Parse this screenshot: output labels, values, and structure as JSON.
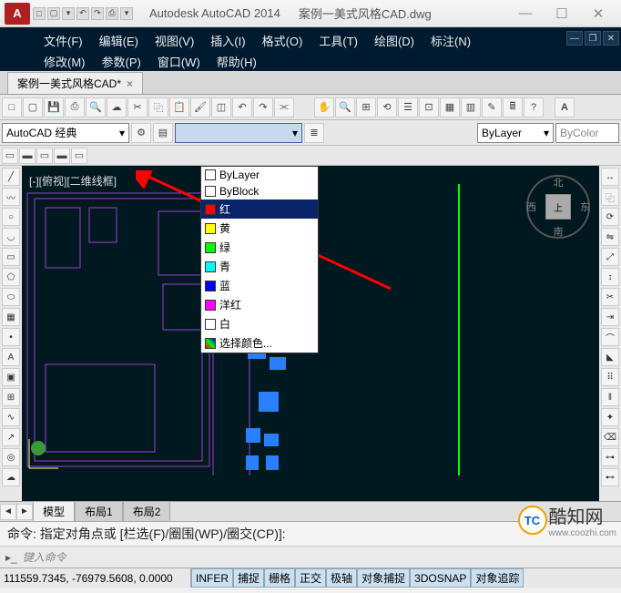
{
  "title": {
    "app": "Autodesk AutoCAD 2014",
    "doc": "案例一美式风格CAD.dwg"
  },
  "menubar": {
    "row1": [
      {
        "label": "文件(F)"
      },
      {
        "label": "编辑(E)"
      },
      {
        "label": "视图(V)"
      },
      {
        "label": "插入(I)"
      },
      {
        "label": "格式(O)"
      },
      {
        "label": "工具(T)"
      },
      {
        "label": "绘图(D)"
      },
      {
        "label": "标注(N)"
      }
    ],
    "row2": [
      {
        "label": "修改(M)"
      },
      {
        "label": "参数(P)"
      },
      {
        "label": "窗口(W)"
      },
      {
        "label": "帮助(H)"
      }
    ]
  },
  "file_tab": {
    "label": "案例一美式风格CAD*"
  },
  "workspace": {
    "label": "AutoCAD 经典"
  },
  "props": {
    "layer_label": "ByLayer",
    "color_label": "ByColor"
  },
  "color_dropdown": {
    "items": [
      {
        "name": "ByLayer",
        "color": "#ffffff"
      },
      {
        "name": "ByBlock",
        "color": "#ffffff"
      },
      {
        "name": "红",
        "color": "#ff0000",
        "selected": true
      },
      {
        "name": "黄",
        "color": "#ffff00"
      },
      {
        "name": "绿",
        "color": "#00ff00"
      },
      {
        "name": "青",
        "color": "#00ffff"
      },
      {
        "name": "蓝",
        "color": "#0000ff"
      },
      {
        "name": "洋红",
        "color": "#ff00ff"
      },
      {
        "name": "白",
        "color": "#ffffff"
      },
      {
        "name": "选择颜色...",
        "color": null
      }
    ],
    "tooltip": "红"
  },
  "view_label": "[-][俯视][二维线框]",
  "nav_cube": {
    "n": "北",
    "s": "南",
    "e": "东",
    "w": "西",
    "face": "上"
  },
  "drawing_tabs": [
    {
      "label": "模型",
      "active": true
    },
    {
      "label": "布局1"
    },
    {
      "label": "布局2"
    }
  ],
  "command": {
    "history": "命令: 指定对角点或 [栏选(F)/圈围(WP)/圈交(CP)]:",
    "prompt": "键入命令"
  },
  "status": {
    "coords": "111559.7345, -76979.5608, 0.0000",
    "buttons": [
      "INFER",
      "捕捉",
      "栅格",
      "正交",
      "极轴",
      "对象捕捉",
      "3DOSNAP",
      "对象追踪"
    ]
  },
  "watermark": {
    "brand": "酷知网",
    "url": "www.coozhi.com",
    "logo": "TC"
  }
}
